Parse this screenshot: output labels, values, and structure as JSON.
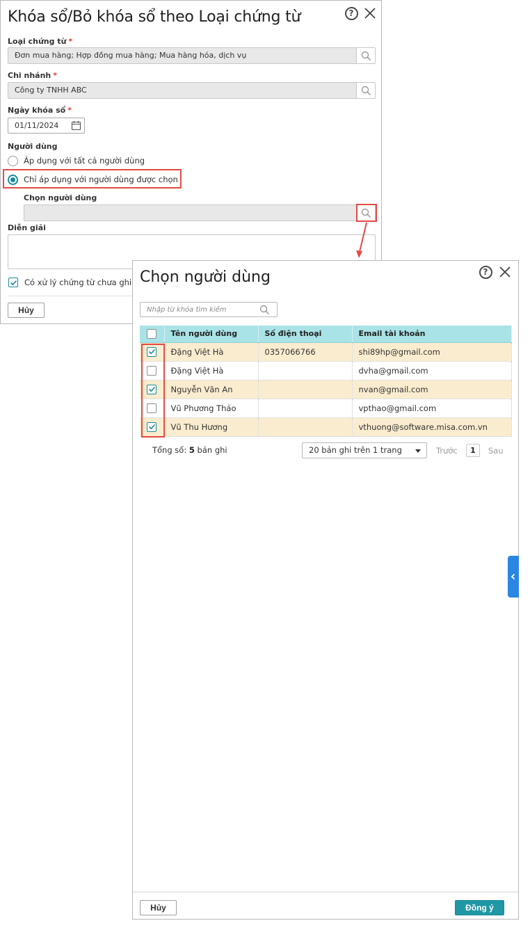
{
  "main_dialog": {
    "title": "Khóa sổ/Bỏ khóa sổ theo Loại chứng từ",
    "help_icon": "?",
    "voucher_type": {
      "label": "Loại chứng từ",
      "required_mark": "*",
      "value": "Đơn mua hàng; Hợp đồng mua hàng; Mua hàng hóa, dịch vụ"
    },
    "branch": {
      "label": "Chi nhánh",
      "required_mark": "*",
      "value": "Công ty TNHH ABC"
    },
    "lock_date": {
      "label": "Ngày khóa sổ",
      "required_mark": "*",
      "value": "01/11/2024"
    },
    "users": {
      "label": "Người dùng",
      "option_all": "Áp dụng với tất cả người dùng",
      "option_selected": "Chỉ áp dụng với người dùng được chọn",
      "selected_option": "option_selected",
      "choose_label": "Chọn người dùng",
      "choose_value": ""
    },
    "description": {
      "label": "Diễn giải",
      "value": ""
    },
    "process_unposted": {
      "label": "Có xử lý chứng từ chưa ghi s",
      "checked": true
    },
    "cancel_label": "Hủy"
  },
  "user_picker": {
    "title": "Chọn người dùng",
    "help_icon": "?",
    "search_placeholder": "Nhập từ khóa tìm kiếm",
    "columns": [
      "Tên người dùng",
      "Số điện thoại",
      "Email tài khoản"
    ],
    "rows": [
      {
        "name": "Đặng Việt Hà",
        "phone": "0357066766",
        "email": "shi89hp@gmail.com",
        "checked": true
      },
      {
        "name": "Đặng Việt Hà",
        "phone": "",
        "email": "dvha@gmail.com",
        "checked": false
      },
      {
        "name": "Nguyễn Văn An",
        "phone": "",
        "email": "nvan@gmail.com",
        "checked": true
      },
      {
        "name": "Vũ Phương Thảo",
        "phone": "",
        "email": "vpthao@gmail.com",
        "checked": false
      },
      {
        "name": "Vũ Thu Hương",
        "phone": "",
        "email": "vthuong@software.misa.com.vn",
        "checked": true
      }
    ],
    "total_prefix": "Tổng số:",
    "total_count": "5",
    "total_suffix": "bản ghi",
    "page_size": "20 bản ghi trên 1 trang",
    "prev_label": "Trước",
    "page_number": "1",
    "next_label": "Sau",
    "cancel_label": "Hủy",
    "ok_label": "Đồng ý"
  },
  "colors": {
    "accent": "#1f97a5",
    "header_row": "#a9e3e7",
    "selected_row": "#faeccf",
    "highlight": "#e34b44",
    "side_tab": "#2b86e3"
  }
}
